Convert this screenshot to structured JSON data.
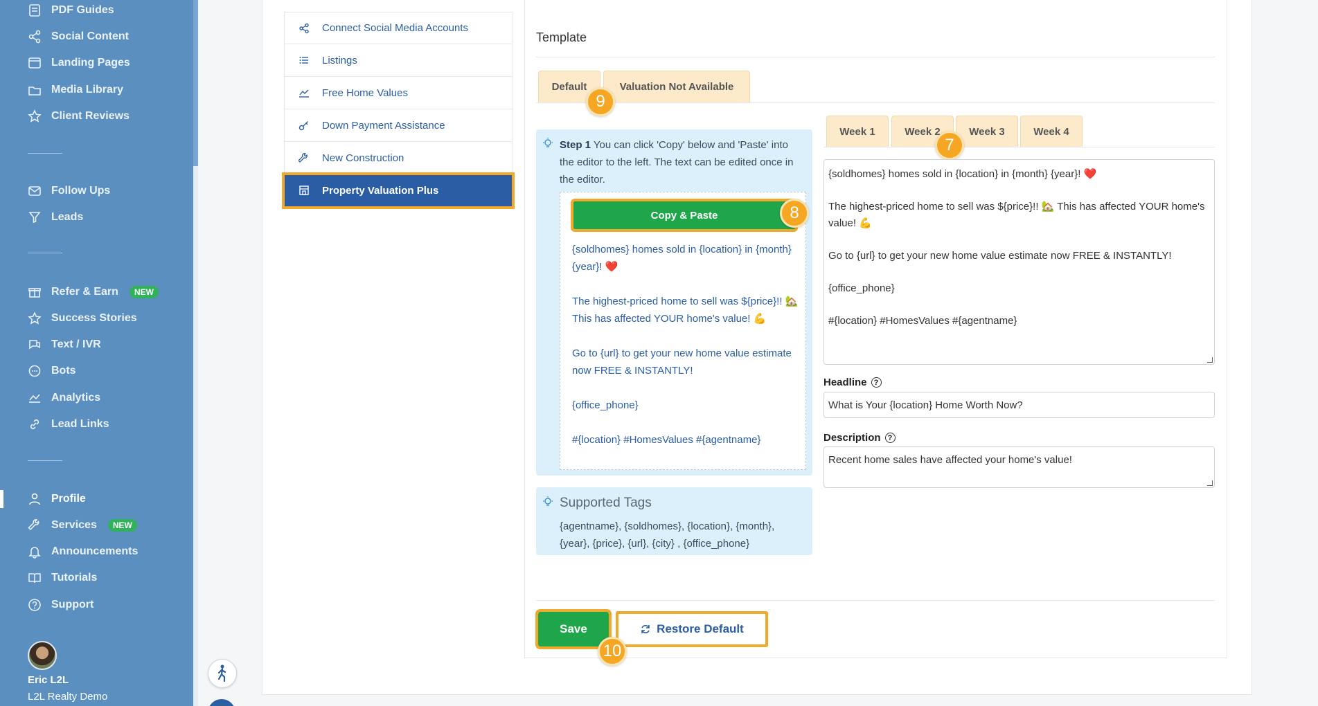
{
  "sidebar": {
    "items": [
      {
        "label": "PDF Guides",
        "icon": "pdf-icon"
      },
      {
        "label": "Social Content",
        "icon": "share-icon"
      },
      {
        "label": "Landing Pages",
        "icon": "browser-icon"
      },
      {
        "label": "Media Library",
        "icon": "folder-icon"
      },
      {
        "label": "Client Reviews",
        "icon": "star-icon"
      },
      {
        "label": "Follow Ups",
        "icon": "mail-icon"
      },
      {
        "label": "Leads",
        "icon": "filter-icon"
      },
      {
        "label": "Refer & Earn",
        "icon": "gift-icon",
        "badge": "NEW"
      },
      {
        "label": "Success Stories",
        "icon": "star-icon"
      },
      {
        "label": "Text / IVR",
        "icon": "chat-icon"
      },
      {
        "label": "Bots",
        "icon": "bot-icon"
      },
      {
        "label": "Analytics",
        "icon": "chart-icon"
      },
      {
        "label": "Lead Links",
        "icon": "link-icon"
      },
      {
        "label": "Profile",
        "icon": "user-icon",
        "active": true
      },
      {
        "label": "Services",
        "icon": "wrench-icon",
        "badge": "NEW"
      },
      {
        "label": "Announcements",
        "icon": "bell-icon"
      },
      {
        "label": "Tutorials",
        "icon": "book-icon"
      },
      {
        "label": "Support",
        "icon": "help-icon"
      }
    ],
    "user": {
      "name": "Eric L2L",
      "org": "L2L Realty Demo"
    }
  },
  "submenu": {
    "items": [
      {
        "label": "Connect Social Media Accounts",
        "icon": "share-icon"
      },
      {
        "label": "Listings",
        "icon": "list-icon"
      },
      {
        "label": "Free Home Values",
        "icon": "chart-icon"
      },
      {
        "label": "Down Payment Assistance",
        "icon": "key-icon"
      },
      {
        "label": "New Construction",
        "icon": "tools-icon"
      },
      {
        "label": "Property Valuation Plus",
        "icon": "building-icon",
        "active": true
      }
    ]
  },
  "main": {
    "title": "Template",
    "tabs": [
      "Default",
      "Valuation Not Available"
    ],
    "week_tabs": [
      "Week 1",
      "Week 2",
      "Week 3",
      "Week 4"
    ],
    "step": {
      "label": "Step 1",
      "text": "You can click 'Copy' below and 'Paste' into the editor to the left. The text can be edited once in the editor.",
      "copy_button": "Copy & Paste",
      "preview": [
        "{soldhomes} homes sold in {location} in {month} {year}! ❤️",
        "The highest-priced home to sell was ${price}!! 🏡 This has affected YOUR home's value! 💪",
        "Go to {url} to get your new home value estimate now FREE & INSTANTLY!",
        "{office_phone}",
        "#{location} #HomesValues #{agentname}"
      ]
    },
    "supported_tags": {
      "title": "Supported Tags",
      "text": "{agentname}, {soldhomes}, {location}, {month}, {year}, {price}, {url}, {city} , {office_phone}"
    },
    "editor": [
      "{soldhomes} homes sold in {location} in {month} {year}! ❤️",
      "The highest-priced home to sell was ${price}!! 🏡 This has affected YOUR home's value! 💪",
      "Go to {url} to get your new home value estimate now FREE & INSTANTLY!",
      "{office_phone}",
      "#{location} #HomesValues #{agentname}"
    ],
    "headline": {
      "label": "Headline",
      "value": "What is Your {location} Home Worth Now?"
    },
    "description": {
      "label": "Description",
      "value": "Recent home sales have affected your home's value!"
    },
    "save_button": "Save",
    "restore_button": "Restore Default"
  },
  "markers": {
    "m7": "7",
    "m8": "8",
    "m9": "9",
    "m10": "10"
  },
  "colors": {
    "sidebar": "#5b8fbf",
    "accent": "#2b5da4",
    "highlight": "#f0a92a",
    "success": "#1fa64a",
    "tab": "#fdeacb"
  }
}
